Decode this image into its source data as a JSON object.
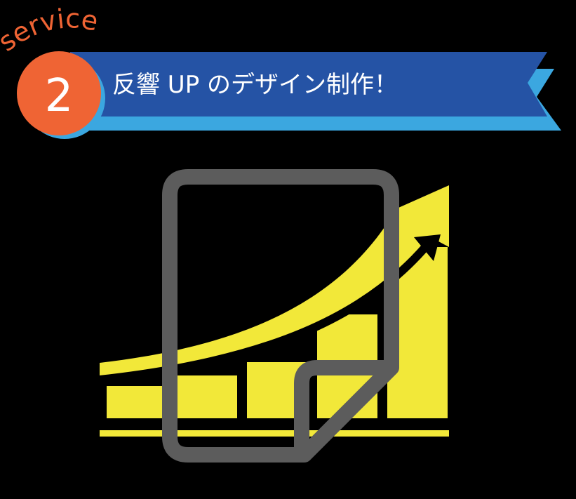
{
  "header": {
    "service_label": "service",
    "service_number": "2",
    "title": "反響 UP のデザイン制作！"
  },
  "illustration": {
    "icons": [
      "rising-bar-chart-icon",
      "growth-arrow-icon",
      "document-page-icon"
    ]
  },
  "colors": {
    "background": "#000000",
    "accent_orange": "#ef6434",
    "banner_blue": "#2553a5",
    "banner_light_blue": "#3ba7e0",
    "chart_yellow": "#f2e839",
    "document_gray": "#5c5c5c",
    "text_white": "#ffffff"
  }
}
